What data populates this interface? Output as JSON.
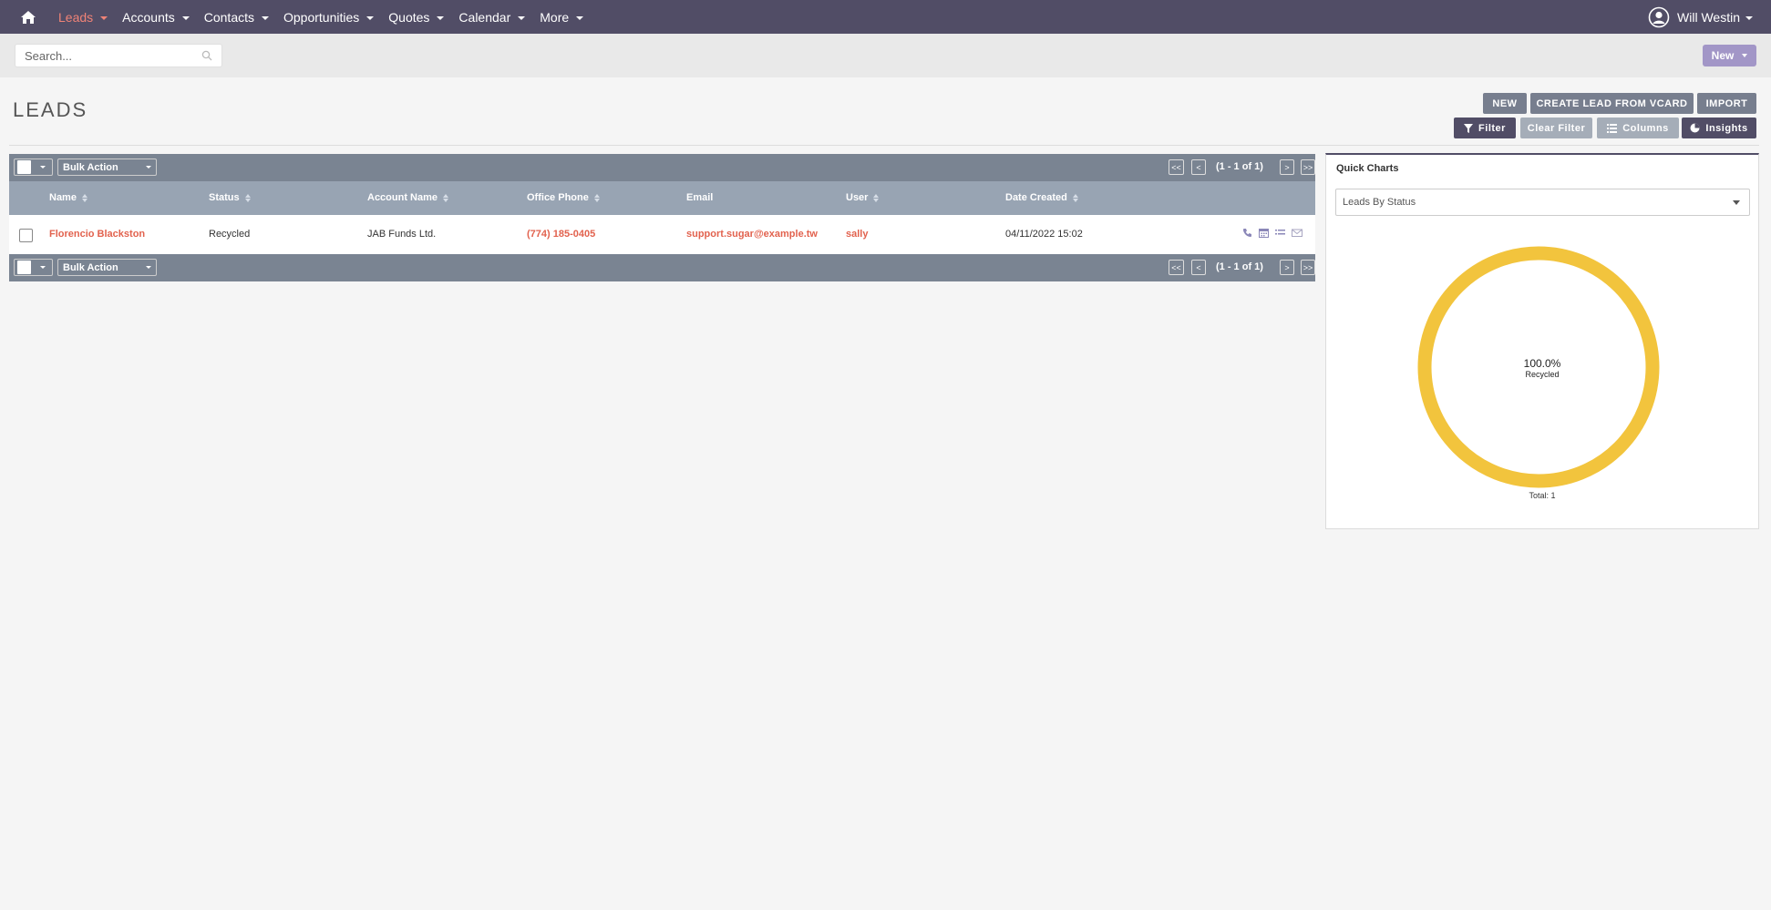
{
  "nav": {
    "items": [
      {
        "label": "Leads",
        "active": true
      },
      {
        "label": "Accounts"
      },
      {
        "label": "Contacts"
      },
      {
        "label": "Opportunities"
      },
      {
        "label": "Quotes"
      },
      {
        "label": "Calendar"
      },
      {
        "label": "More"
      }
    ],
    "user_name": "Will Westin"
  },
  "search": {
    "placeholder": "Search..."
  },
  "subbar": {
    "new_label": "New"
  },
  "page": {
    "title": "LEADS"
  },
  "actions": {
    "new": "NEW",
    "create_vcard": "CREATE LEAD FROM VCARD",
    "import": "IMPORT",
    "filter": "Filter",
    "clear_filter": "Clear Filter",
    "columns": "Columns",
    "insights": "Insights"
  },
  "list": {
    "bulk_action": "Bulk Action",
    "pagination": "(1 - 1 of 1)",
    "pager": {
      "first": "<<",
      "prev": "<",
      "next": ">",
      "last": ">>"
    },
    "columns": [
      "Name",
      "Status",
      "Account Name",
      "Office Phone",
      "Email",
      "User",
      "Date Created"
    ],
    "rows": [
      {
        "name": "Florencio Blackston",
        "status": "Recycled",
        "account_name": "JAB Funds Ltd.",
        "office_phone": "(774) 185-0405",
        "email": "support.sugar@example.tw",
        "user": "sally",
        "date_created": "04/11/2022 15:02"
      }
    ]
  },
  "quick_charts": {
    "title": "Quick Charts",
    "selected_chart": "Leads By Status",
    "center_percent": "100.0%",
    "center_label": "Recycled",
    "total": "Total: 1"
  },
  "chart_data": {
    "type": "pie",
    "categories": [
      "Recycled"
    ],
    "values": [
      1
    ],
    "colors": [
      "#f2c43d"
    ]
  },
  "colors": {
    "nav_bg": "#514d66",
    "accent_link": "#e2624e",
    "new_button": "#a296c7",
    "list_bar": "#7a8492",
    "list_header": "#98a4b3"
  }
}
